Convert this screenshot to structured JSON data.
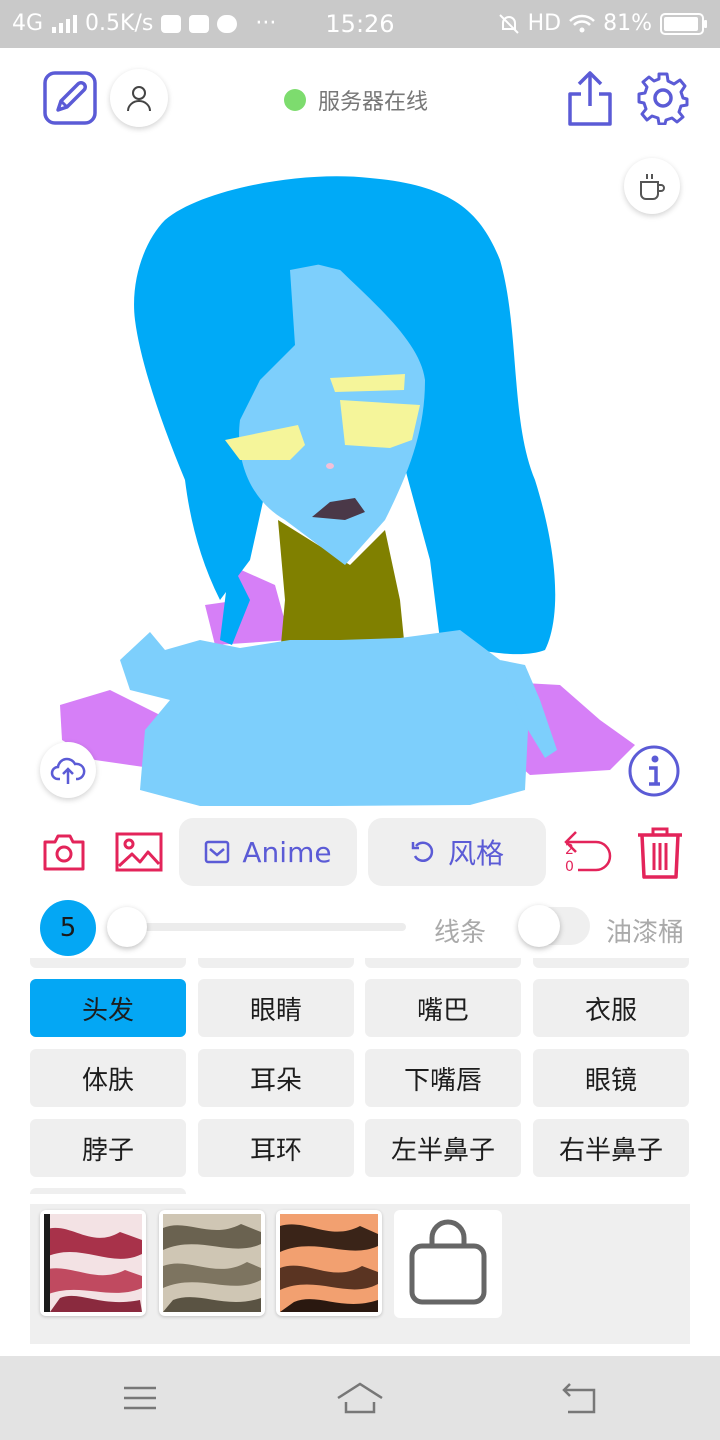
{
  "status_bar": {
    "network": "4G",
    "speed": "0.5K/s",
    "dots": "···",
    "time": "15:26",
    "hd": "HD",
    "battery": "81%"
  },
  "header": {
    "server_status": "服务器在线",
    "server_status_color": "#7ddc6e"
  },
  "icons": {
    "draw": "sketch-pen-icon",
    "user": "user-icon",
    "share": "share-icon",
    "settings": "gear-icon",
    "coffee": "coffee-cup-icon",
    "upload": "cloud-upload-icon",
    "info": "info-icon",
    "camera": "camera-icon",
    "gallery": "image-icon",
    "undo": "undo-icon",
    "trash": "trash-icon",
    "shop": "shopping-bag-icon"
  },
  "toolbar": {
    "anime_label": "Anime",
    "style_label": "风格",
    "undo_count_a": "2",
    "undo_count_b": "0"
  },
  "brush": {
    "size": "5",
    "size_level": 0.0,
    "line_label": "线条",
    "bucket_label": "油漆桶",
    "bucket_enabled": false
  },
  "parts": [
    {
      "label": "头发",
      "selected": true
    },
    {
      "label": "眼睛",
      "selected": false
    },
    {
      "label": "嘴巴",
      "selected": false
    },
    {
      "label": "衣服",
      "selected": false
    },
    {
      "label": "体肤",
      "selected": false
    },
    {
      "label": "耳朵",
      "selected": false
    },
    {
      "label": "下嘴唇",
      "selected": false
    },
    {
      "label": "眼镜",
      "selected": false
    },
    {
      "label": "脖子",
      "selected": false
    },
    {
      "label": "耳环",
      "selected": false
    },
    {
      "label": "左半鼻子",
      "selected": false
    },
    {
      "label": "右半鼻子",
      "selected": false
    }
  ],
  "colors": {
    "accent": "#04a7f4",
    "purple": "#5b5bd6",
    "red": "#e3245a",
    "hair": "#00aaf7",
    "skin": "#7dcffc",
    "neck": "#808000",
    "eyes": "#f5f59a",
    "mouth": "#4a3848",
    "background_fill": "#d67ff7"
  }
}
